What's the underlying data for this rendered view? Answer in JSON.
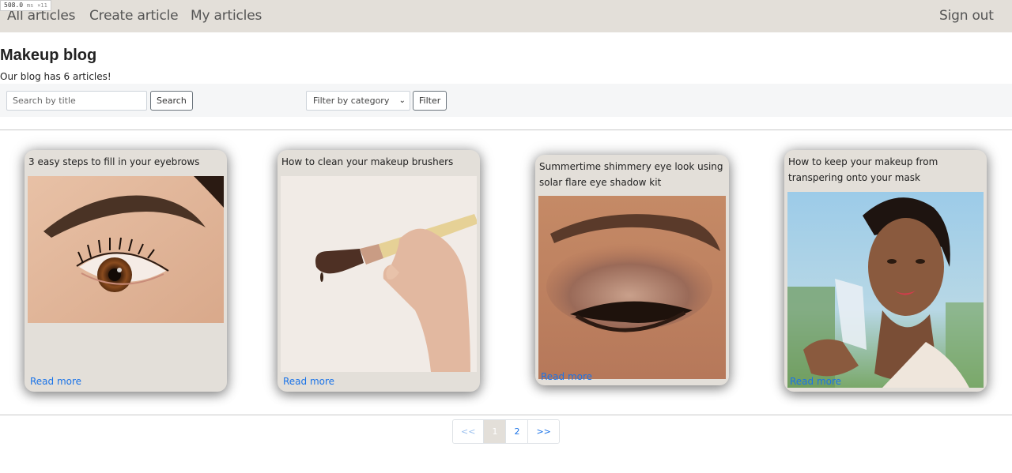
{
  "perf": {
    "ms": "508.0",
    "unit": "ms",
    "extra": "×11"
  },
  "nav": {
    "all_articles": "All articles",
    "create_article": "Create article",
    "my_articles": "My articles",
    "sign_out": "Sign out"
  },
  "page": {
    "title": "Makeup blog",
    "count_text": "Our blog has 6 articles!"
  },
  "filters": {
    "search_placeholder": "Search by title",
    "search_button": "Search",
    "category_selected": "Filter by category",
    "filter_button": "Filter"
  },
  "articles": [
    {
      "title": "3 easy steps to fill in your eyebrows",
      "link": "Read more",
      "image": "eyebrow-closeup"
    },
    {
      "title": "How to clean your makeup brushers",
      "link": "Read more",
      "image": "makeup-brush-in-hand"
    },
    {
      "title": "Summertime shimmery eye look using solar flare eye shadow kit",
      "link": "Read more",
      "image": "shimmery-eye-makeup"
    },
    {
      "title": "How to keep your makeup from transpering onto your mask",
      "link": "Read more",
      "image": "woman-removing-mask"
    }
  ],
  "pagination": {
    "prev": "<<",
    "pages": [
      "1",
      "2"
    ],
    "current": "1",
    "next": ">>"
  },
  "colors": {
    "navbar_bg": "#e3dfd9",
    "card_bg": "#e3dfd9",
    "link": "#1a73e8"
  },
  "icons": {
    "select_chevron": "chevron-down-icon"
  }
}
